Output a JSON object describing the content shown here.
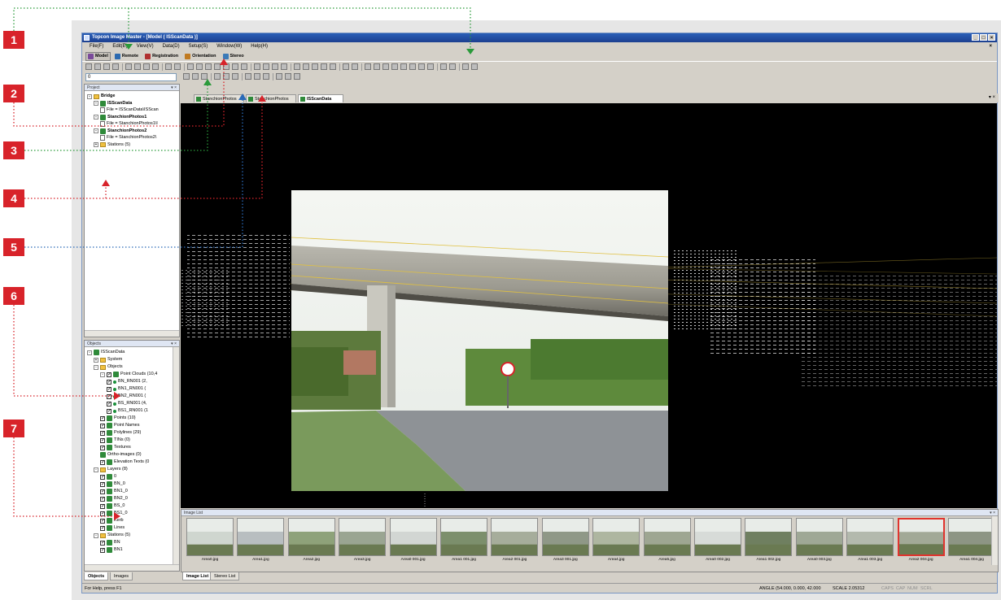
{
  "callouts": [
    "1",
    "2",
    "3",
    "4",
    "5",
    "6",
    "7"
  ],
  "window": {
    "title": "Topcon Image Master - [Model ( ISScanData )]",
    "controls": [
      "_",
      "□",
      "×"
    ]
  },
  "menu": [
    "File(F)",
    "Edit(E)",
    "View(V)",
    "Data(D)",
    "Setup(S)",
    "Window(W)",
    "Help(H)"
  ],
  "menu_close": "×",
  "modes": [
    {
      "label": "Model",
      "color": "#7a4a9a",
      "active": true
    },
    {
      "label": "Remote",
      "color": "#2c6ab0",
      "active": false
    },
    {
      "label": "Registration",
      "color": "#b03030",
      "active": false
    },
    {
      "label": "Orientation",
      "color": "#c07a20",
      "active": false
    },
    {
      "label": "Stereo",
      "color": "#3a7ab8",
      "active": false
    }
  ],
  "layer_select": {
    "value": "0"
  },
  "project_panel": {
    "title": "Project",
    "pins": "▾ ×",
    "rows": [
      {
        "text": "Bridge",
        "indent": 0,
        "icon": "folder",
        "exp": "-",
        "bold": true
      },
      {
        "text": "ISScanData",
        "indent": 1,
        "icon": "group",
        "exp": "-",
        "bold": true
      },
      {
        "text": "File = ISScanData\\ISScan",
        "indent": 2,
        "icon": "doc",
        "exp": "",
        "bold": false
      },
      {
        "text": "StanchionPhotos1",
        "indent": 1,
        "icon": "group",
        "exp": "-",
        "bold": true
      },
      {
        "text": "File = StanchionPhotos1\\I",
        "indent": 2,
        "icon": "doc",
        "exp": "",
        "bold": false
      },
      {
        "text": "StanchionPhotos2",
        "indent": 1,
        "icon": "group",
        "exp": "-",
        "bold": true
      },
      {
        "text": "File = StanchionPhotos2\\",
        "indent": 2,
        "icon": "doc",
        "exp": "",
        "bold": false
      },
      {
        "text": "Stations (5)",
        "indent": 1,
        "icon": "folder",
        "exp": "+",
        "bold": false
      }
    ]
  },
  "objects_panel": {
    "title": "Objects",
    "pins": "▾ ×",
    "rows": [
      {
        "text": "ISScanData",
        "indent": 0,
        "icon": "group",
        "exp": "-",
        "cb": false
      },
      {
        "text": "System",
        "indent": 1,
        "icon": "folder",
        "exp": "+",
        "cb": false
      },
      {
        "text": "Objects",
        "indent": 1,
        "icon": "folder",
        "exp": "-",
        "cb": false
      },
      {
        "text": "Point Clouds (10,4",
        "indent": 2,
        "icon": "pc",
        "exp": "-",
        "cb": true
      },
      {
        "text": "BN_RN001 (2,",
        "indent": 3,
        "icon": "dot",
        "exp": "",
        "cb": true
      },
      {
        "text": "BN1_RN001 (",
        "indent": 3,
        "icon": "dot",
        "exp": "",
        "cb": true
      },
      {
        "text": "BN2_RN001 (",
        "indent": 3,
        "icon": "dot",
        "exp": "",
        "cb": true
      },
      {
        "text": "BS_RN001 (4,",
        "indent": 3,
        "icon": "dot",
        "exp": "",
        "cb": true
      },
      {
        "text": "BS1_RN001 (1",
        "indent": 3,
        "icon": "dot",
        "exp": "",
        "cb": true
      },
      {
        "text": "Points (10)",
        "indent": 2,
        "icon": "pts",
        "exp": "",
        "cb": true
      },
      {
        "text": "Point Names",
        "indent": 2,
        "icon": "abc",
        "exp": "",
        "cb": true
      },
      {
        "text": "Polylines (29)",
        "indent": 2,
        "icon": "poly",
        "exp": "",
        "cb": true
      },
      {
        "text": "TINs (0)",
        "indent": 2,
        "icon": "tin",
        "exp": "",
        "cb": true
      },
      {
        "text": "Textures",
        "indent": 2,
        "icon": "tex",
        "exp": "",
        "cb": true
      },
      {
        "text": "Ortho-images (0)",
        "indent": 2,
        "icon": "ortho",
        "exp": "",
        "cb": false
      },
      {
        "text": "Elevation Texts (0",
        "indent": 2,
        "icon": "elev",
        "exp": "",
        "cb": true
      },
      {
        "text": "Layers (8)",
        "indent": 1,
        "icon": "folder",
        "exp": "-",
        "cb": false
      },
      {
        "text": "0",
        "indent": 2,
        "icon": "layer",
        "exp": "",
        "cb": true
      },
      {
        "text": "BN_0",
        "indent": 2,
        "icon": "layer",
        "exp": "",
        "cb": true
      },
      {
        "text": "BN1_0",
        "indent": 2,
        "icon": "layer",
        "exp": "",
        "cb": true
      },
      {
        "text": "BN2_0",
        "indent": 2,
        "icon": "layer",
        "exp": "",
        "cb": true
      },
      {
        "text": "BS_0",
        "indent": 2,
        "icon": "layer",
        "exp": "",
        "cb": true
      },
      {
        "text": "BS1_0",
        "indent": 2,
        "icon": "layer",
        "exp": "",
        "cb": true
      },
      {
        "text": "Kerb",
        "indent": 2,
        "icon": "layer",
        "exp": "",
        "cb": true
      },
      {
        "text": "Lines",
        "indent": 2,
        "icon": "layer",
        "exp": "",
        "cb": true
      },
      {
        "text": "Stations (5)",
        "indent": 1,
        "icon": "folder",
        "exp": "-",
        "cb": false
      },
      {
        "text": "BN",
        "indent": 2,
        "icon": "station",
        "exp": "",
        "cb": true
      },
      {
        "text": "BN1",
        "indent": 2,
        "icon": "station",
        "exp": "",
        "cb": true
      }
    ]
  },
  "left_tabs": [
    "Objects",
    "Images"
  ],
  "doc_tabs": [
    {
      "label": "StanchionPhotos",
      "active": false
    },
    {
      "label": "StanchionPhotos",
      "active": false
    },
    {
      "label": "ISScanData",
      "active": true
    }
  ],
  "doc_tab_controls": "▾ ×",
  "image_list": {
    "title": "Image List",
    "pins": "▾ ×",
    "thumbs": [
      {
        "label": "Area0.jpg",
        "tone": "#cfd6cf",
        "selected": false
      },
      {
        "label": "Area1.jpg",
        "tone": "#b8bec0",
        "selected": false
      },
      {
        "label": "Area2.jpg",
        "tone": "#8ea27a",
        "selected": false
      },
      {
        "label": "Area3.jpg",
        "tone": "#9aa592",
        "selected": false
      },
      {
        "label": "Area0 001.jpg",
        "tone": "#d2d6d3",
        "selected": false
      },
      {
        "label": "Area1 001.jpg",
        "tone": "#7c8f6c",
        "selected": false
      },
      {
        "label": "Area2 001.jpg",
        "tone": "#a6ad9b",
        "selected": false
      },
      {
        "label": "Area3 001.jpg",
        "tone": "#8f9887",
        "selected": false
      },
      {
        "label": "Area4.jpg",
        "tone": "#aeb6a0",
        "selected": false
      },
      {
        "label": "Area5.jpg",
        "tone": "#9ea692",
        "selected": false
      },
      {
        "label": "Area0 002.jpg",
        "tone": "#d7dbd8",
        "selected": false
      },
      {
        "label": "Area1 002.jpg",
        "tone": "#6f7f60",
        "selected": false
      },
      {
        "label": "Area0 003.jpg",
        "tone": "#9fa896",
        "selected": false
      },
      {
        "label": "Area1 003.jpg",
        "tone": "#b3b9ad",
        "selected": false
      },
      {
        "label": "Area2 004.jpg",
        "tone": "#a2a997",
        "selected": true
      },
      {
        "label": "Area1 004.jpg",
        "tone": "#8d9584",
        "selected": false
      }
    ]
  },
  "bottom_tabs": [
    "Image List",
    "Stereo List"
  ],
  "status": {
    "help": "For Help, press F1",
    "angle": "ANGLE  (54.000, 0.000,  42.000",
    "scale": "SCALE 2.05312",
    "indicators": [
      "CAPS",
      "CAP",
      "NUM",
      "SCRL"
    ]
  },
  "colors": {
    "callout": "#d8232a",
    "lead_green": "#2a9a3a",
    "lead_red": "#d8232a",
    "lead_blue": "#2a6ab8",
    "selection": "#e0342e"
  }
}
